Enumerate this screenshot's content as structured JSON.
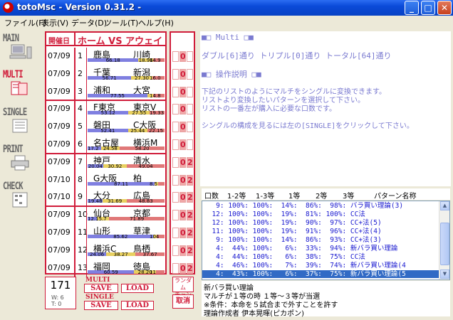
{
  "window": {
    "title": "totoMsc - Version 0.31.2 -",
    "min": "_",
    "max": "□",
    "close": "✕"
  },
  "menu": [
    "ファイル(F)",
    "表示(V)",
    "データ(D)",
    "ツール(T)",
    "ヘルプ(H)"
  ],
  "nav": [
    {
      "label": "MAIN",
      "icon": "computer-icon"
    },
    {
      "label": "MULTI",
      "icon": "multi-sheet-icon"
    },
    {
      "label": "SINGLE",
      "icon": "single-sheet-icon"
    },
    {
      "label": "PRINT",
      "icon": "printer-icon"
    },
    {
      "label": "CHECK",
      "icon": "check-sheet-icon"
    }
  ],
  "table": {
    "date_header": "開催日",
    "teams_header": "ホーム VS アウェイ",
    "matches": [
      {
        "date": "07/09",
        "no": "1",
        "home": "鹿島",
        "away": "川崎",
        "p1": "66.18",
        "p0": "18.96",
        "p2": "14.9",
        "v": [
          66.18,
          18.96,
          14.9
        ],
        "pick": [
          "",
          "0",
          ""
        ]
      },
      {
        "date": "07/09",
        "no": "2",
        "home": "千葉",
        "away": "新潟",
        "p1": "56.71",
        "p0": "27.30",
        "p2": "16.0",
        "v": [
          56.71,
          27.3,
          16.0
        ],
        "pick": [
          "",
          "0",
          ""
        ]
      },
      {
        "date": "07/09",
        "no": "3",
        "home": "浦和",
        "away": "大宮",
        "p1": "77.55",
        "p0": "",
        "p2": "14.8",
        "v": [
          77.55,
          7.65,
          14.8
        ],
        "pick": [
          "",
          "0",
          ""
        ]
      },
      {
        "date": "07/09",
        "no": "4",
        "home": "F東京",
        "away": "東京V",
        "p1": "53.12",
        "p0": "27.55",
        "p2": "19.33",
        "v": [
          53.12,
          27.55,
          19.33
        ],
        "pick": [
          "",
          "0",
          ""
        ]
      },
      {
        "date": "07/09",
        "no": "5",
        "home": "磐田",
        "away": "C大阪",
        "p1": "52.41",
        "p0": "25.44",
        "p2": "22.15",
        "v": [
          52.41,
          25.44,
          22.15
        ],
        "pick": [
          "",
          "0",
          ""
        ]
      },
      {
        "date": "07/09",
        "no": "6",
        "home": "名古屋",
        "away": "横浜M",
        "p1": "17.2",
        "p0": "24.58",
        "p2": "58.20",
        "v": [
          17.2,
          24.58,
          58.2
        ],
        "pick": [
          "",
          "0",
          ""
        ]
      },
      {
        "date": "07/09",
        "no": "7",
        "home": "神戸",
        "away": "清水",
        "p1": "20.04",
        "p0": "30.92",
        "p2": "49.04",
        "v": [
          20.04,
          30.92,
          49.04
        ],
        "pick": [
          "",
          "0",
          "2"
        ]
      },
      {
        "date": "07/10",
        "no": "8",
        "home": "G大阪",
        "away": "柏",
        "p1": "87.11",
        "p0": "",
        "p2": "8.5",
        "v": [
          87.11,
          4.39,
          8.5
        ],
        "pick": [
          "",
          "0",
          "2"
        ]
      },
      {
        "date": "07/10",
        "no": "9",
        "home": "大分",
        "away": "広島",
        "p1": "19.48",
        "p0": "31.69",
        "p2": "48.83",
        "v": [
          19.48,
          31.69,
          48.83
        ],
        "pick": [
          "",
          "0",
          "2"
        ]
      },
      {
        "date": "07/09",
        "no": "10",
        "home": "仙台",
        "away": "京都",
        "p1": "12.15.7",
        "p0": "",
        "p2": "71.89",
        "v": [
          12.1,
          16.01,
          71.89
        ],
        "pick": [
          "",
          "0",
          "2"
        ]
      },
      {
        "date": "07/09",
        "no": "11",
        "home": "山形",
        "away": "草津",
        "p1": "85.62",
        "p0": "",
        "p2": "104",
        "v": [
          85.62,
          4.0,
          10.38
        ],
        "pick": [
          "",
          "0",
          "2"
        ]
      },
      {
        "date": "07/09",
        "no": "12",
        "home": "横浜C",
        "away": "鳥栖",
        "p1": "24.06",
        "p0": "38.27",
        "p2": "37.67",
        "v": [
          24.06,
          38.27,
          37.67
        ],
        "pick": [
          "",
          "0",
          "2"
        ]
      },
      {
        "date": "07/09",
        "no": "13",
        "home": "福岡",
        "away": "徳島",
        "p1": "60.59",
        "p0": "28.20",
        "p2": "11",
        "v": [
          60.59,
          28.2,
          11.2
        ],
        "pick": [
          "",
          "0",
          "2"
        ]
      }
    ]
  },
  "count": {
    "total": "171",
    "w": "W: 6",
    "t": "T: 0"
  },
  "multi": {
    "label": "MULTI",
    "save": "SAVE",
    "load": "LOAD"
  },
  "single": {
    "label": "SINGLE",
    "save": "SAVE",
    "load": "LOAD"
  },
  "random": {
    "line1": "ランダム",
    "line2": "チャンス"
  },
  "cancel": "取消",
  "info": {
    "multi_heading": "■□ Multi □■",
    "multi_line": "ダブル[6]通り トリプル[0]通り トータル[64]通り",
    "help_heading": "■□ 操作説明 □■",
    "help_lines": [
      "下記のリストのようにマルチをシングルに変換できます。",
      "リストより変換したいパターンを選択して下さい。",
      "リストの一番左が購入に必要な口数です。",
      "",
      "シングルの構成を見るには左の[SINGLE]をクリックして下さい。"
    ]
  },
  "combo_header": [
    "口数",
    "1-2等",
    "1-3等",
    "1等",
    "2等",
    "3等",
    "パターン名称"
  ],
  "combo_rows": [
    "   9: 100%: 100%:  14%:  86%:  98%: バラ買い理論(3)",
    "  12: 100%: 100%:  19%:  81%: 100%: CC法",
    "  12: 100%: 100%:  19%:  90%:  97%: CC+法(5)",
    "  11: 100%: 100%:  19%:  91%:  96%: CC+法(4)",
    "   9: 100%: 100%:  14%:  86%:  93%: CC+法(3)",
    "   4:  44%: 100%:   6%:  33%:  94%: 新バラ買い理論",
    "   4:  44%: 100%:   6%:  38%:  75%: CC法",
    "   4:  46%: 100%:   7%:  39%:  74%: 新バラ買い理論(4",
    "   4:  43%: 100%:   6%:  37%:  75%: 新バラ買い理論(5"
  ],
  "desc": [
    "新バラ買い理論",
    "マルチが１等の時 １等～３等が当選",
    "※条件：本命を５試合まで外すことを許す",
    "理論作成者 伊本晃暉(ピカポン)"
  ],
  "colors": {
    "accent": "#d01c3a",
    "bar1": "#7f7fe0",
    "bar0": "#e8d060",
    "bar2": "#e07878",
    "list_text": "#1a1ad0",
    "info_text": "#7a7ad0"
  }
}
